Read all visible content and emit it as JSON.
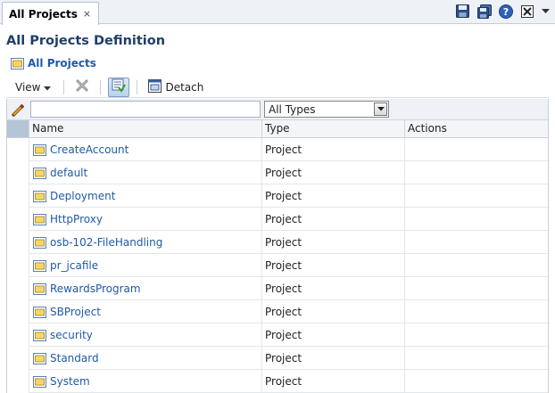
{
  "tab": {
    "label": "All Projects",
    "close": "×"
  },
  "page": {
    "title": "All Projects Definition",
    "breadcrumb": "All Projects"
  },
  "toolbar": {
    "view_label": "View",
    "detach_label": "Detach"
  },
  "filter": {
    "name_value": "",
    "type_value": "All Types"
  },
  "columns": {
    "name": "Name",
    "type": "Type",
    "actions": "Actions"
  },
  "rows": [
    {
      "name": "CreateAccount",
      "type": "Project"
    },
    {
      "name": "default",
      "type": "Project"
    },
    {
      "name": "Deployment",
      "type": "Project"
    },
    {
      "name": "HttpProxy",
      "type": "Project"
    },
    {
      "name": "osb-102-FileHandling",
      "type": "Project"
    },
    {
      "name": "pr_jcafile",
      "type": "Project"
    },
    {
      "name": "RewardsProgram",
      "type": "Project"
    },
    {
      "name": "SBProject",
      "type": "Project"
    },
    {
      "name": "security",
      "type": "Project"
    },
    {
      "name": "Standard",
      "type": "Project"
    },
    {
      "name": "System",
      "type": "Project"
    }
  ],
  "icons": {
    "save": "save-icon",
    "save_all": "save-all-icon",
    "help": "help-icon",
    "close_all": "close-all-icon",
    "menu": "chevron-down-icon",
    "folder": "folder-icon",
    "delete": "delete-icon",
    "query_by_example": "filter-icon",
    "detach": "detach-icon"
  },
  "colors": {
    "link": "#1f5aa6",
    "title": "#1f3e6b",
    "header_corner": "#b5c4d6"
  }
}
